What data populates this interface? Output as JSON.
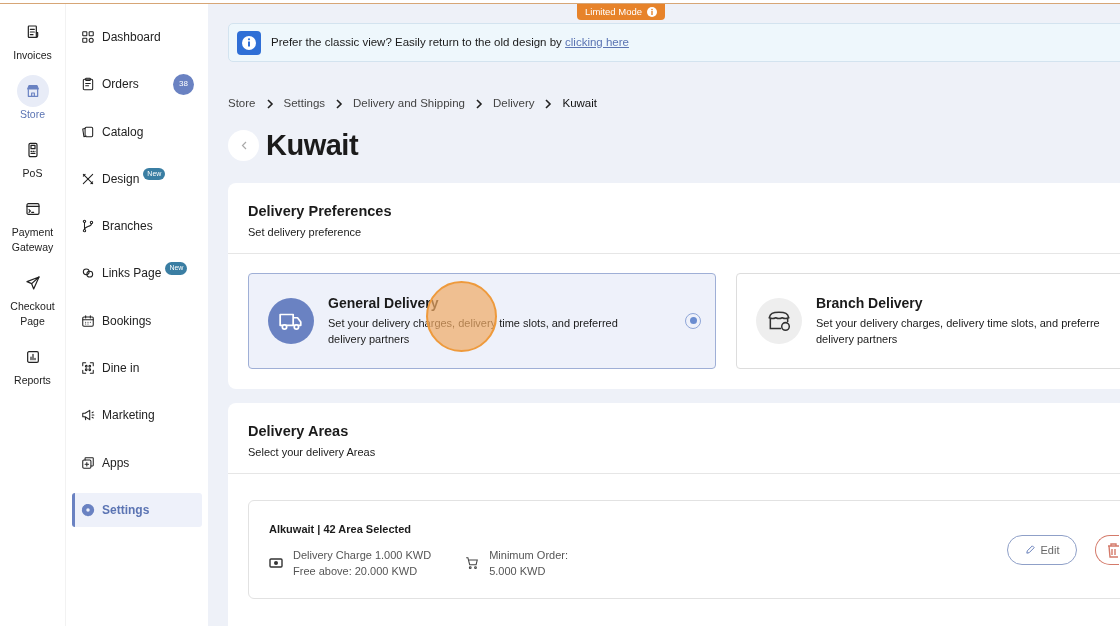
{
  "limited_mode": {
    "label": "Limited Mode"
  },
  "rail": [
    {
      "label": "Invoices",
      "selected": false
    },
    {
      "label": "Store",
      "selected": true
    },
    {
      "label": "PoS",
      "selected": false
    },
    {
      "label": "Payment Gateway",
      "selected": false
    },
    {
      "label": "Checkout Page",
      "selected": false
    },
    {
      "label": "Reports",
      "selected": false
    }
  ],
  "sidebar": {
    "items": [
      {
        "label": "Dashboard",
        "selected": false
      },
      {
        "label": "Orders",
        "selected": false,
        "count": "38"
      },
      {
        "label": "Catalog",
        "selected": false
      },
      {
        "label": "Design",
        "selected": false,
        "tag": "New"
      },
      {
        "label": "Branches",
        "selected": false
      },
      {
        "label": "Links Page",
        "selected": false,
        "tag": "New"
      },
      {
        "label": "Bookings",
        "selected": false
      },
      {
        "label": "Dine in",
        "selected": false
      },
      {
        "label": "Marketing",
        "selected": false
      },
      {
        "label": "Apps",
        "selected": false
      },
      {
        "label": "Settings",
        "selected": true
      }
    ]
  },
  "banner": {
    "text": "Prefer the classic view? Easily return to the old design by",
    "link": "clicking here"
  },
  "breadcrumb": [
    "Store",
    "Settings",
    "Delivery and Shipping",
    "Delivery",
    "Kuwait"
  ],
  "page_title": "Kuwait",
  "preferences": {
    "title": "Delivery Preferences",
    "subtitle": "Set delivery preference",
    "options": [
      {
        "title": "General Delivery",
        "description_lines": [
          "Set your delivery charges, delivery time slots, and preferred",
          "delivery partners"
        ],
        "selected": true
      },
      {
        "title": "Branch Delivery",
        "description_lines": [
          "Set your delivery charges, delivery time slots, and preferre",
          "delivery partners"
        ],
        "selected": false
      }
    ]
  },
  "areas": {
    "title": "Delivery Areas",
    "subtitle": "Select your delivery Areas",
    "entries": [
      {
        "name": "Alkuwait | 42 Area Selected",
        "charge_lines": [
          "Delivery Charge 1.000 KWD",
          "Free above: 20.000 KWD"
        ],
        "minimum_lines": [
          "Minimum Order:",
          "5.000 KWD"
        ],
        "edit": "Edit"
      }
    ]
  }
}
